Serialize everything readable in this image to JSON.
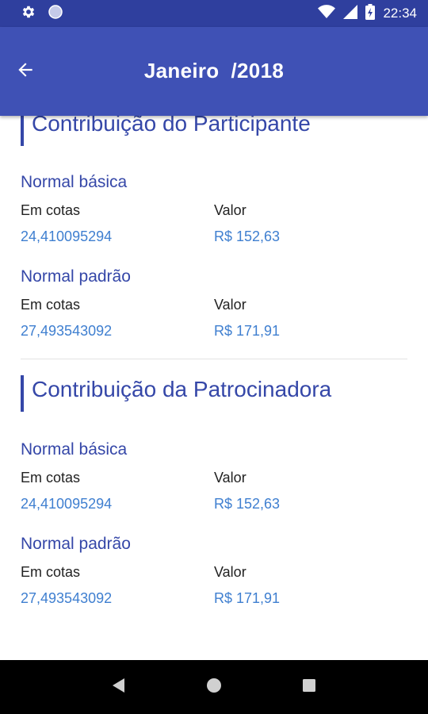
{
  "status_bar": {
    "time": "22:34",
    "icons": [
      "settings-gear-icon",
      "circle-notification-icon",
      "wifi-icon",
      "signal-icon",
      "battery-charging-icon"
    ]
  },
  "app_bar": {
    "title": "Janeiro  /2018",
    "back_icon": "arrow-back-icon"
  },
  "sections": [
    {
      "title": "Contribuição do Participante",
      "groups": [
        {
          "title": "Normal básica",
          "label_left": "Em cotas",
          "label_right": "Valor",
          "value_left": "24,410095294",
          "value_right": "R$ 152,63"
        },
        {
          "title": "Normal padrão",
          "label_left": "Em cotas",
          "label_right": "Valor",
          "value_left": "27,493543092",
          "value_right": "R$ 171,91"
        }
      ]
    },
    {
      "title": "Contribuição da Patrocinadora",
      "groups": [
        {
          "title": "Normal básica",
          "label_left": "Em cotas",
          "label_right": "Valor",
          "value_left": "24,410095294",
          "value_right": "R$ 152,63"
        },
        {
          "title": "Normal padrão",
          "label_left": "Em cotas",
          "label_right": "Valor",
          "value_left": "27,493543092",
          "value_right": "R$ 171,91"
        }
      ]
    }
  ],
  "nav_bar": {
    "icons": [
      "back-triangle-icon",
      "home-circle-icon",
      "recents-square-icon"
    ]
  },
  "colors": {
    "primary": "#3f51b5",
    "primary_dark": "#2f3f9e",
    "heading": "#3547a8",
    "value": "#3f7fd0"
  }
}
